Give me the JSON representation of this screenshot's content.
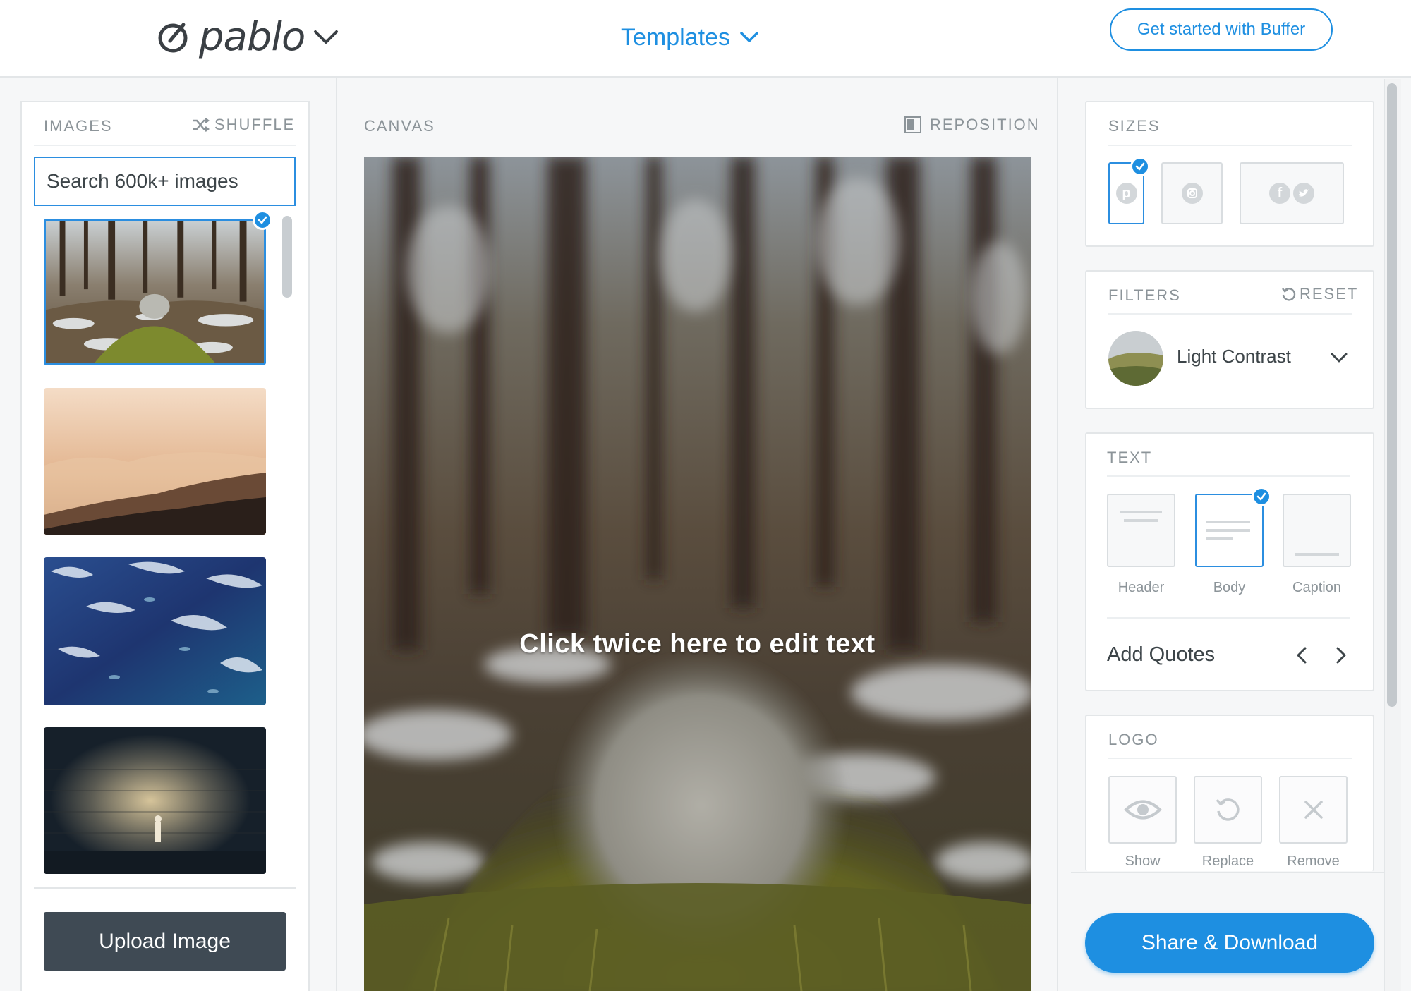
{
  "header": {
    "logo_text": "pablo",
    "templates_label": "Templates",
    "cta_label": "Get started with Buffer"
  },
  "images_panel": {
    "title": "IMAGES",
    "shuffle_label": "SHUFFLE",
    "search_placeholder": "Search 600k+ images",
    "thumbnails": [
      {
        "name": "forest-moss-log",
        "selected": true
      },
      {
        "name": "misty-mountains",
        "selected": false
      },
      {
        "name": "ocean-fish",
        "selected": false
      },
      {
        "name": "stone-wall-figure",
        "selected": false
      }
    ],
    "upload_label": "Upload Image"
  },
  "canvas": {
    "title": "CANVAS",
    "reposition_label": "REPOSITION",
    "overlay_text": "Click twice here to edit text"
  },
  "sizes": {
    "title": "SIZES",
    "options": [
      {
        "icon": "pinterest-icon",
        "selected": true
      },
      {
        "icon": "instagram-icon",
        "selected": false
      },
      {
        "icon": "facebook-twitter-icon",
        "selected": false
      }
    ]
  },
  "filters": {
    "title": "FILTERS",
    "reset_label": "RESET",
    "selected": "Light Contrast"
  },
  "text": {
    "title": "TEXT",
    "options": {
      "header": "Header",
      "body": "Body",
      "caption": "Caption"
    },
    "selected": "Body",
    "add_quotes_label": "Add Quotes"
  },
  "logo": {
    "title": "LOGO",
    "options": {
      "show": "Show",
      "replace": "Replace",
      "remove": "Remove"
    }
  },
  "share_label": "Share & Download",
  "colors": {
    "accent": "#1e8fe1",
    "upload_button": "#3f4a54",
    "label_gray": "#8c9499"
  }
}
